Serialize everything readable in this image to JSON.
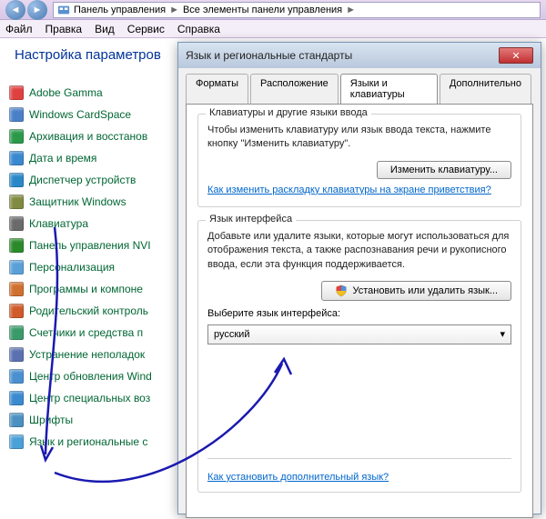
{
  "nav": {
    "back_glyph": "◄",
    "fwd_glyph": "►"
  },
  "breadcrumb": {
    "seg1": "Панель управления",
    "seg2": "Все элементы панели управления",
    "sep": "►"
  },
  "menu": {
    "file": "Файл",
    "edit": "Правка",
    "view": "Вид",
    "services": "Сервис",
    "help": "Справка"
  },
  "page_title": "Настройка параметров",
  "sidebar": {
    "items": [
      {
        "label": "Adobe Gamma",
        "color": "#e04040"
      },
      {
        "label": "Windows CardSpace",
        "color": "#4a80c8"
      },
      {
        "label": "Архивация и восстанов",
        "color": "#2a9a4a"
      },
      {
        "label": "Дата и время",
        "color": "#3a88d0"
      },
      {
        "label": "Диспетчер устройств",
        "color": "#2a88c8"
      },
      {
        "label": "Защитник Windows",
        "color": "#808a40"
      },
      {
        "label": "Клавиатура",
        "color": "#6a6a6a"
      },
      {
        "label": "Панель управления NVI",
        "color": "#2a8a2a"
      },
      {
        "label": "Персонализация",
        "color": "#5aa0d8"
      },
      {
        "label": "Программы и компоне",
        "color": "#d07030"
      },
      {
        "label": "Родительский контроль",
        "color": "#d05a2a"
      },
      {
        "label": "Счетчики и средства п",
        "color": "#3a9a6a"
      },
      {
        "label": "Устранение неполадок",
        "color": "#5a70b0"
      },
      {
        "label": "Центр обновления Wind",
        "color": "#4a90d0"
      },
      {
        "label": "Центр специальных воз",
        "color": "#3a8ad0"
      },
      {
        "label": "Шрифты",
        "color": "#4a90c0"
      },
      {
        "label": "Язык и региональные с",
        "color": "#4aa0d8"
      }
    ]
  },
  "dialog": {
    "title": "Язык и региональные стандарты",
    "close_glyph": "✕",
    "tabs": {
      "formats": "Форматы",
      "location": "Расположение",
      "keyboards": "Языки и клавиатуры",
      "advanced": "Дополнительно"
    },
    "group1": {
      "title": "Клавиатуры и другие языки ввода",
      "desc": "Чтобы изменить клавиатуру или язык ввода текста, нажмите кнопку \"Изменить клавиатуру\".",
      "button": "Изменить клавиатуру...",
      "link": "Как изменить раскладку клавиатуры на экране приветствия?"
    },
    "group2": {
      "title": "Язык интерфейса",
      "desc": "Добавьте или удалите языки, которые могут использоваться для отображения текста, а также распознавания речи и рукописного ввода, если эта функция поддерживается.",
      "install_btn": "Установить или удалить язык...",
      "select_label": "Выберите язык интерфейса:",
      "selected": "русский",
      "chevron": "▾",
      "link": "Как установить дополнительный язык?"
    }
  }
}
